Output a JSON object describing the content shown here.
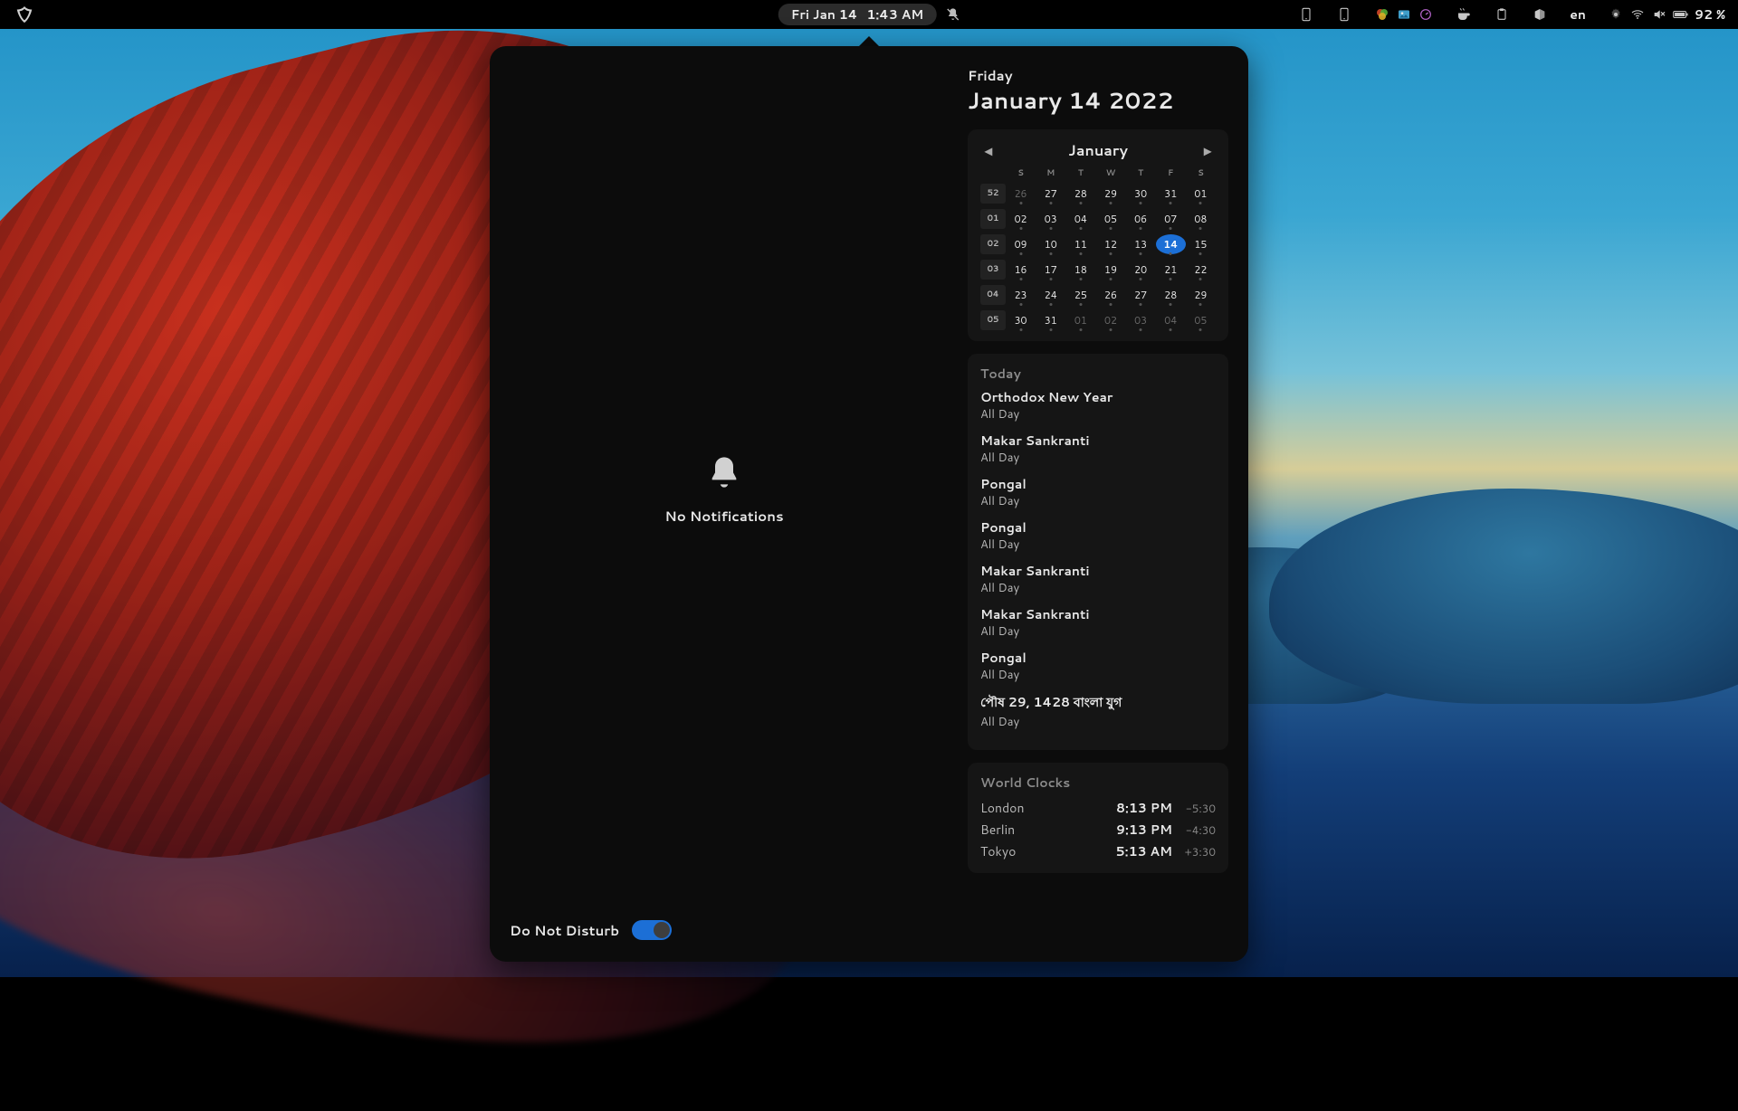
{
  "topbar": {
    "date": "Fri Jan 14",
    "time": "1:43 AM",
    "language": "en",
    "battery_percent": "92 %"
  },
  "notifications": {
    "empty_text": "No Notifications",
    "dnd_label": "Do Not Disturb"
  },
  "header": {
    "dow": "Friday",
    "full": "January 14 2022"
  },
  "calendar": {
    "month": "January",
    "dows": [
      "S",
      "M",
      "T",
      "W",
      "T",
      "F",
      "S"
    ],
    "weeks": [
      {
        "wk": "52",
        "days": [
          {
            "n": "26",
            "dim": true,
            "dot": true
          },
          {
            "n": "27",
            "dot": true
          },
          {
            "n": "28",
            "dot": true
          },
          {
            "n": "29",
            "dot": true
          },
          {
            "n": "30",
            "dot": true
          },
          {
            "n": "31",
            "dot": true
          },
          {
            "n": "01",
            "dot": true
          }
        ]
      },
      {
        "wk": "01",
        "days": [
          {
            "n": "02",
            "dot": true
          },
          {
            "n": "03",
            "dot": true
          },
          {
            "n": "04",
            "dot": true
          },
          {
            "n": "05",
            "dot": true
          },
          {
            "n": "06",
            "dot": true
          },
          {
            "n": "07",
            "dot": true
          },
          {
            "n": "08",
            "dot": true
          }
        ]
      },
      {
        "wk": "02",
        "days": [
          {
            "n": "09",
            "dot": true
          },
          {
            "n": "10",
            "dot": true
          },
          {
            "n": "11",
            "dot": true
          },
          {
            "n": "12",
            "dot": true
          },
          {
            "n": "13",
            "dot": true
          },
          {
            "n": "14",
            "dot": true,
            "today": true
          },
          {
            "n": "15",
            "dot": true
          }
        ]
      },
      {
        "wk": "03",
        "days": [
          {
            "n": "16",
            "dot": true
          },
          {
            "n": "17",
            "dot": true
          },
          {
            "n": "18",
            "dot": true
          },
          {
            "n": "19",
            "dot": true
          },
          {
            "n": "20",
            "dot": true
          },
          {
            "n": "21",
            "dot": true
          },
          {
            "n": "22",
            "dot": true
          }
        ]
      },
      {
        "wk": "04",
        "days": [
          {
            "n": "23",
            "dot": true
          },
          {
            "n": "24",
            "dot": true
          },
          {
            "n": "25",
            "dot": true
          },
          {
            "n": "26",
            "dot": true
          },
          {
            "n": "27",
            "dot": true
          },
          {
            "n": "28",
            "dot": true
          },
          {
            "n": "29",
            "dot": true
          }
        ]
      },
      {
        "wk": "05",
        "days": [
          {
            "n": "30",
            "dot": true
          },
          {
            "n": "31",
            "dot": true
          },
          {
            "n": "01",
            "dim": true,
            "dot": true
          },
          {
            "n": "02",
            "dim": true,
            "dot": true
          },
          {
            "n": "03",
            "dim": true,
            "dot": true
          },
          {
            "n": "04",
            "dim": true,
            "dot": true
          },
          {
            "n": "05",
            "dim": true,
            "dot": true
          }
        ]
      }
    ]
  },
  "events": {
    "section": "Today",
    "items": [
      {
        "title": "Orthodox New Year",
        "sub": "All Day"
      },
      {
        "title": "Makar Sankranti",
        "sub": "All Day"
      },
      {
        "title": "Pongal",
        "sub": "All Day"
      },
      {
        "title": "Pongal",
        "sub": "All Day"
      },
      {
        "title": "Makar Sankranti",
        "sub": "All Day"
      },
      {
        "title": "Makar Sankranti",
        "sub": "All Day"
      },
      {
        "title": "Pongal",
        "sub": "All Day"
      },
      {
        "title": "পৌষ 29, 1428 বাংলা যুগ",
        "sub": "All Day"
      }
    ]
  },
  "clocks": {
    "section": "World Clocks",
    "items": [
      {
        "city": "London",
        "time": "8:13 PM",
        "offset": "-5:30"
      },
      {
        "city": "Berlin",
        "time": "9:13 PM",
        "offset": "-4:30"
      },
      {
        "city": "Tokyo",
        "time": "5:13 AM",
        "offset": "+3:30"
      }
    ]
  }
}
